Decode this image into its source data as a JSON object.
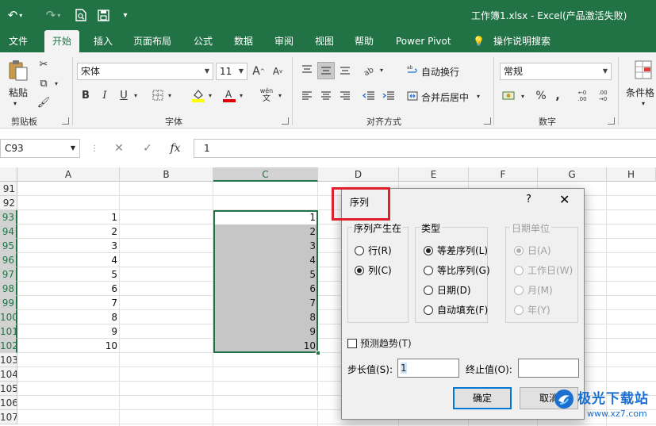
{
  "window": {
    "title": "工作簿1.xlsx  -  Excel(产品激活失败)"
  },
  "quick_access": {
    "undo_icon": "undo-icon",
    "redo_icon": "redo-icon",
    "print_preview_icon": "print-preview-icon",
    "save_icon": "save-icon",
    "customize_icon": "customize-icon"
  },
  "tabs": [
    "文件",
    "开始",
    "插入",
    "页面布局",
    "公式",
    "数据",
    "审阅",
    "视图",
    "帮助",
    "Power Pivot",
    "操作说明搜索"
  ],
  "active_tab": "开始",
  "ribbon": {
    "clipboard": {
      "label": "剪贴板",
      "paste": "粘贴"
    },
    "font": {
      "label": "字体",
      "font_name": "宋体",
      "font_size": "11",
      "bold": "B",
      "italic": "I",
      "underline": "U",
      "grow": "A",
      "shrink": "A",
      "phonetic": "wén"
    },
    "alignment": {
      "label": "对齐方式",
      "wrap": "自动换行",
      "merge": "合并后居中"
    },
    "number": {
      "label": "数字",
      "format": "常规",
      "percent": "%",
      "comma": ","
    },
    "styles": {
      "conditional": "条件格"
    }
  },
  "formula_bar": {
    "name_box": "C93",
    "fx": "fx",
    "value": "1"
  },
  "sheet": {
    "columns": [
      "A",
      "B",
      "C",
      "D",
      "E",
      "F",
      "G",
      "H"
    ],
    "selected_column": "C",
    "rows": [
      "91",
      "92",
      "93",
      "94",
      "95",
      "96",
      "97",
      "98",
      "99",
      "100",
      "101",
      "102",
      "103",
      "104",
      "105",
      "106",
      "107"
    ],
    "col_a_values": [
      "1",
      "2",
      "3",
      "4",
      "5",
      "6",
      "7",
      "8",
      "9",
      "10"
    ],
    "col_c_values": [
      "1",
      "2",
      "3",
      "4",
      "5",
      "6",
      "7",
      "8",
      "9",
      "10"
    ]
  },
  "dialog": {
    "title": "序列",
    "help": "?",
    "close": "✕",
    "series_in": {
      "legend": "序列产生在",
      "row": "行(R)",
      "column": "列(C)",
      "selected": "column"
    },
    "type": {
      "legend": "类型",
      "linear": "等差序列(L)",
      "growth": "等比序列(G)",
      "date": "日期(D)",
      "autofill": "自动填充(F)",
      "selected": "linear"
    },
    "date_unit": {
      "legend": "日期单位",
      "day": "日(A)",
      "weekday": "工作日(W)",
      "month": "月(M)",
      "year": "年(Y)"
    },
    "trend": "预测趋势(T)",
    "step_label": "步长值(S):",
    "step_value": "1",
    "stop_label": "终止值(O):",
    "stop_value": "",
    "ok": "确定",
    "cancel": "取消"
  },
  "watermark": {
    "brand": "极光下载站",
    "url": "www.xz7.com"
  }
}
